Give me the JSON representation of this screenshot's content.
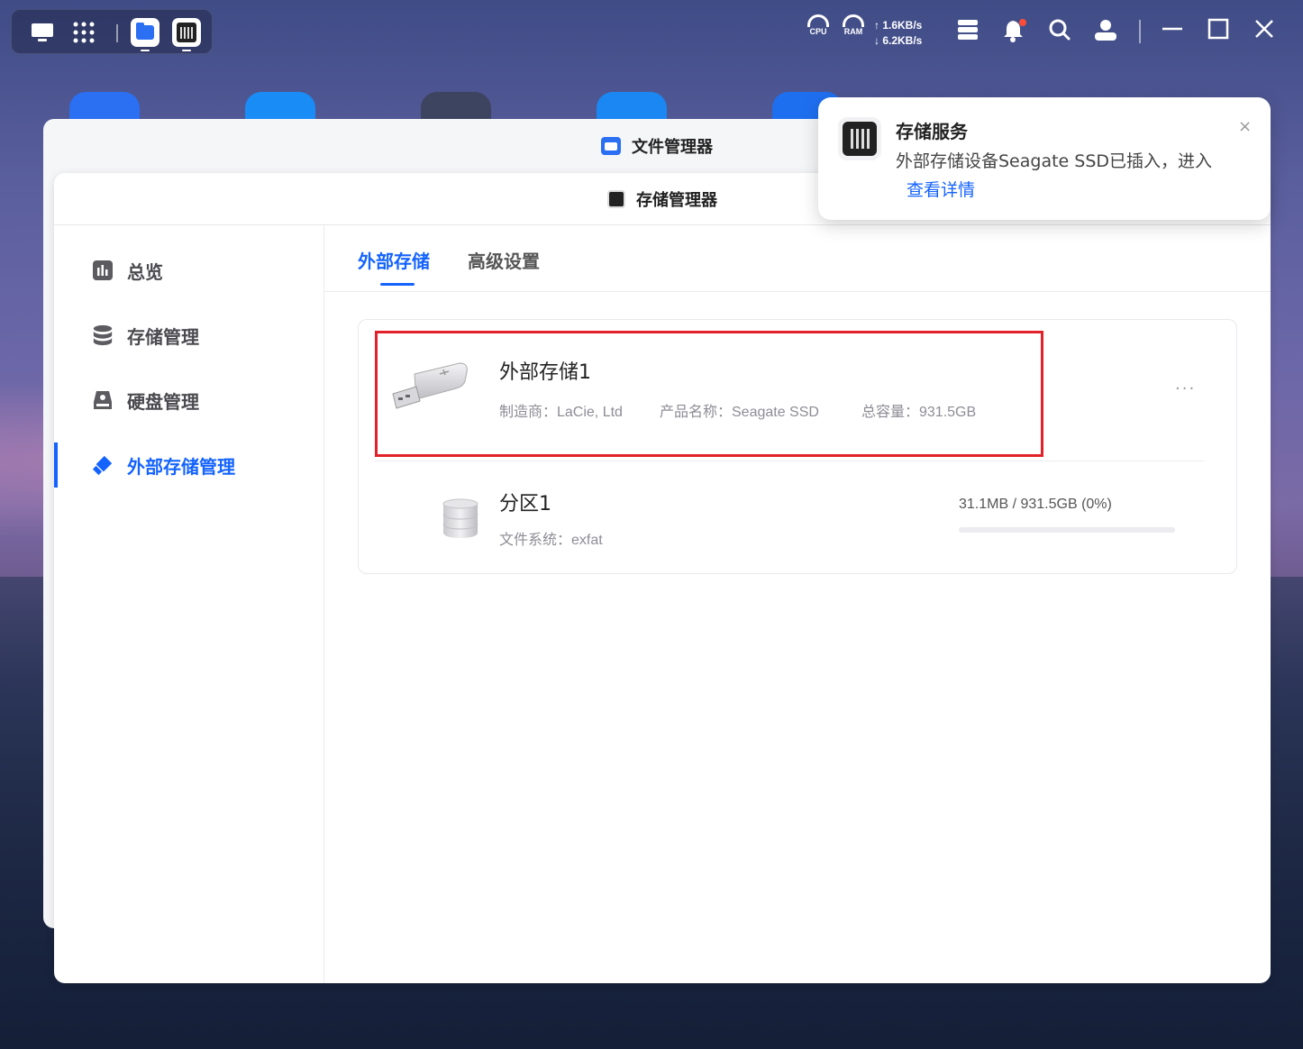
{
  "topbar": {
    "cpu_label": "CPU",
    "ram_label": "RAM",
    "upload_speed": "↑ 1.6KB/s",
    "download_speed": "↓ 6.2KB/s"
  },
  "outer_window": {
    "title": "文件管理器"
  },
  "inner_window": {
    "title": "存储管理器"
  },
  "sidebar": {
    "items": [
      {
        "label": "总览",
        "icon": "chart-icon"
      },
      {
        "label": "存储管理",
        "icon": "database-icon"
      },
      {
        "label": "硬盘管理",
        "icon": "disk-icon"
      },
      {
        "label": "外部存储管理",
        "icon": "usb-icon",
        "active": true
      }
    ]
  },
  "tabs": [
    {
      "label": "外部存储",
      "active": true
    },
    {
      "label": "高级设置"
    }
  ],
  "device": {
    "name": "外部存储1",
    "manufacturer": "制造商：LaCie, Ltd",
    "product": "产品名称：Seagate SSD",
    "capacity": "总容量：931.5GB",
    "more": "···"
  },
  "partition": {
    "name": "分区1",
    "filesystem": "文件系统：exfat",
    "usage": "31.1MB / 931.5GB (0%)",
    "usage_fraction": 0.0
  },
  "notification": {
    "title": "存储服务",
    "message": "外部存储设备Seagate SSD已插入，进入",
    "link": "查看详情",
    "close": "×"
  },
  "colors": {
    "accent": "#1463ff",
    "highlight": "#e3212a"
  }
}
